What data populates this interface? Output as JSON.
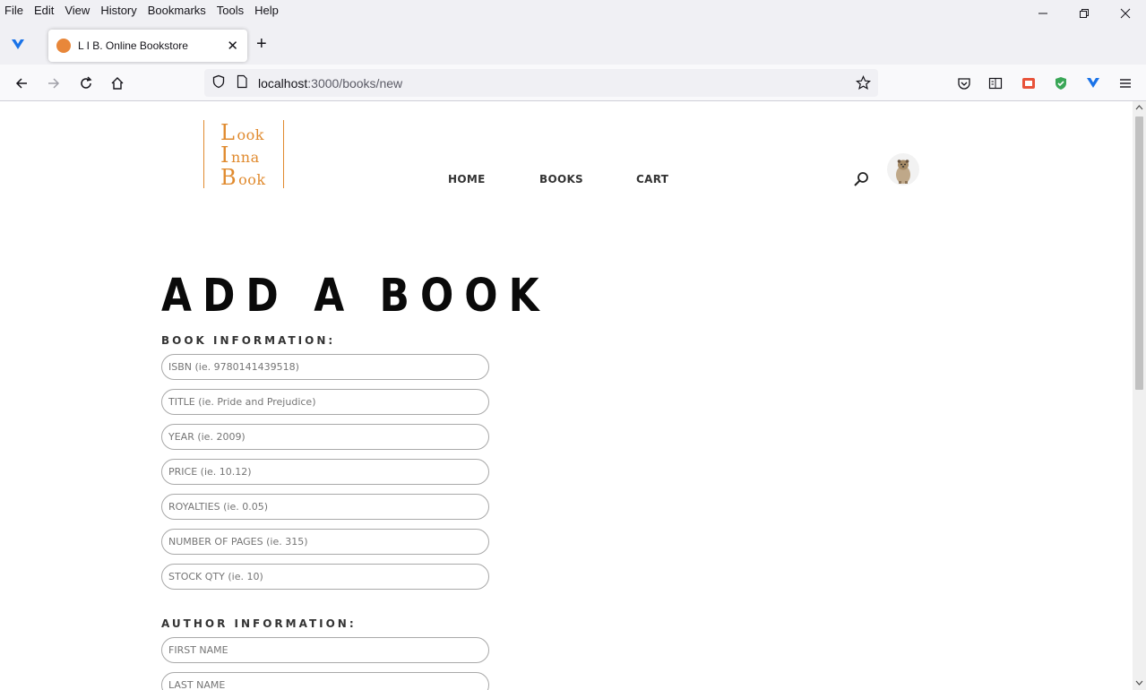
{
  "browser": {
    "menu": [
      "File",
      "Edit",
      "View",
      "History",
      "Bookmarks",
      "Tools",
      "Help"
    ],
    "tab": {
      "title": "L I B. Online Bookstore"
    },
    "url": {
      "host": "localhost",
      "path": ":3000/books/new"
    }
  },
  "site": {
    "logo": [
      {
        "cap": "L",
        "rest": "ook"
      },
      {
        "cap": "I",
        "rest": "nna"
      },
      {
        "cap": "B",
        "rest": "ook"
      }
    ],
    "nav": {
      "home": "HOME",
      "books": "BOOKS",
      "cart": "CART"
    }
  },
  "form": {
    "title": "ADD A BOOK",
    "book_section": "BOOK INFORMATION:",
    "book_fields": [
      "ISBN (ie. 9780141439518)",
      "TITLE (ie. Pride and Prejudice)",
      "YEAR (ie. 2009)",
      "PRICE (ie. 10.12)",
      "ROYALTIES (ie. 0.05)",
      "NUMBER OF PAGES (ie. 315)",
      "STOCK QTY (ie. 10)"
    ],
    "author_section": "AUTHOR INFORMATION:",
    "author_fields": [
      "FIRST NAME",
      "LAST NAME"
    ]
  },
  "colors": {
    "brand_orange": "#e08a2e",
    "title_black": "#0a0a0a"
  }
}
